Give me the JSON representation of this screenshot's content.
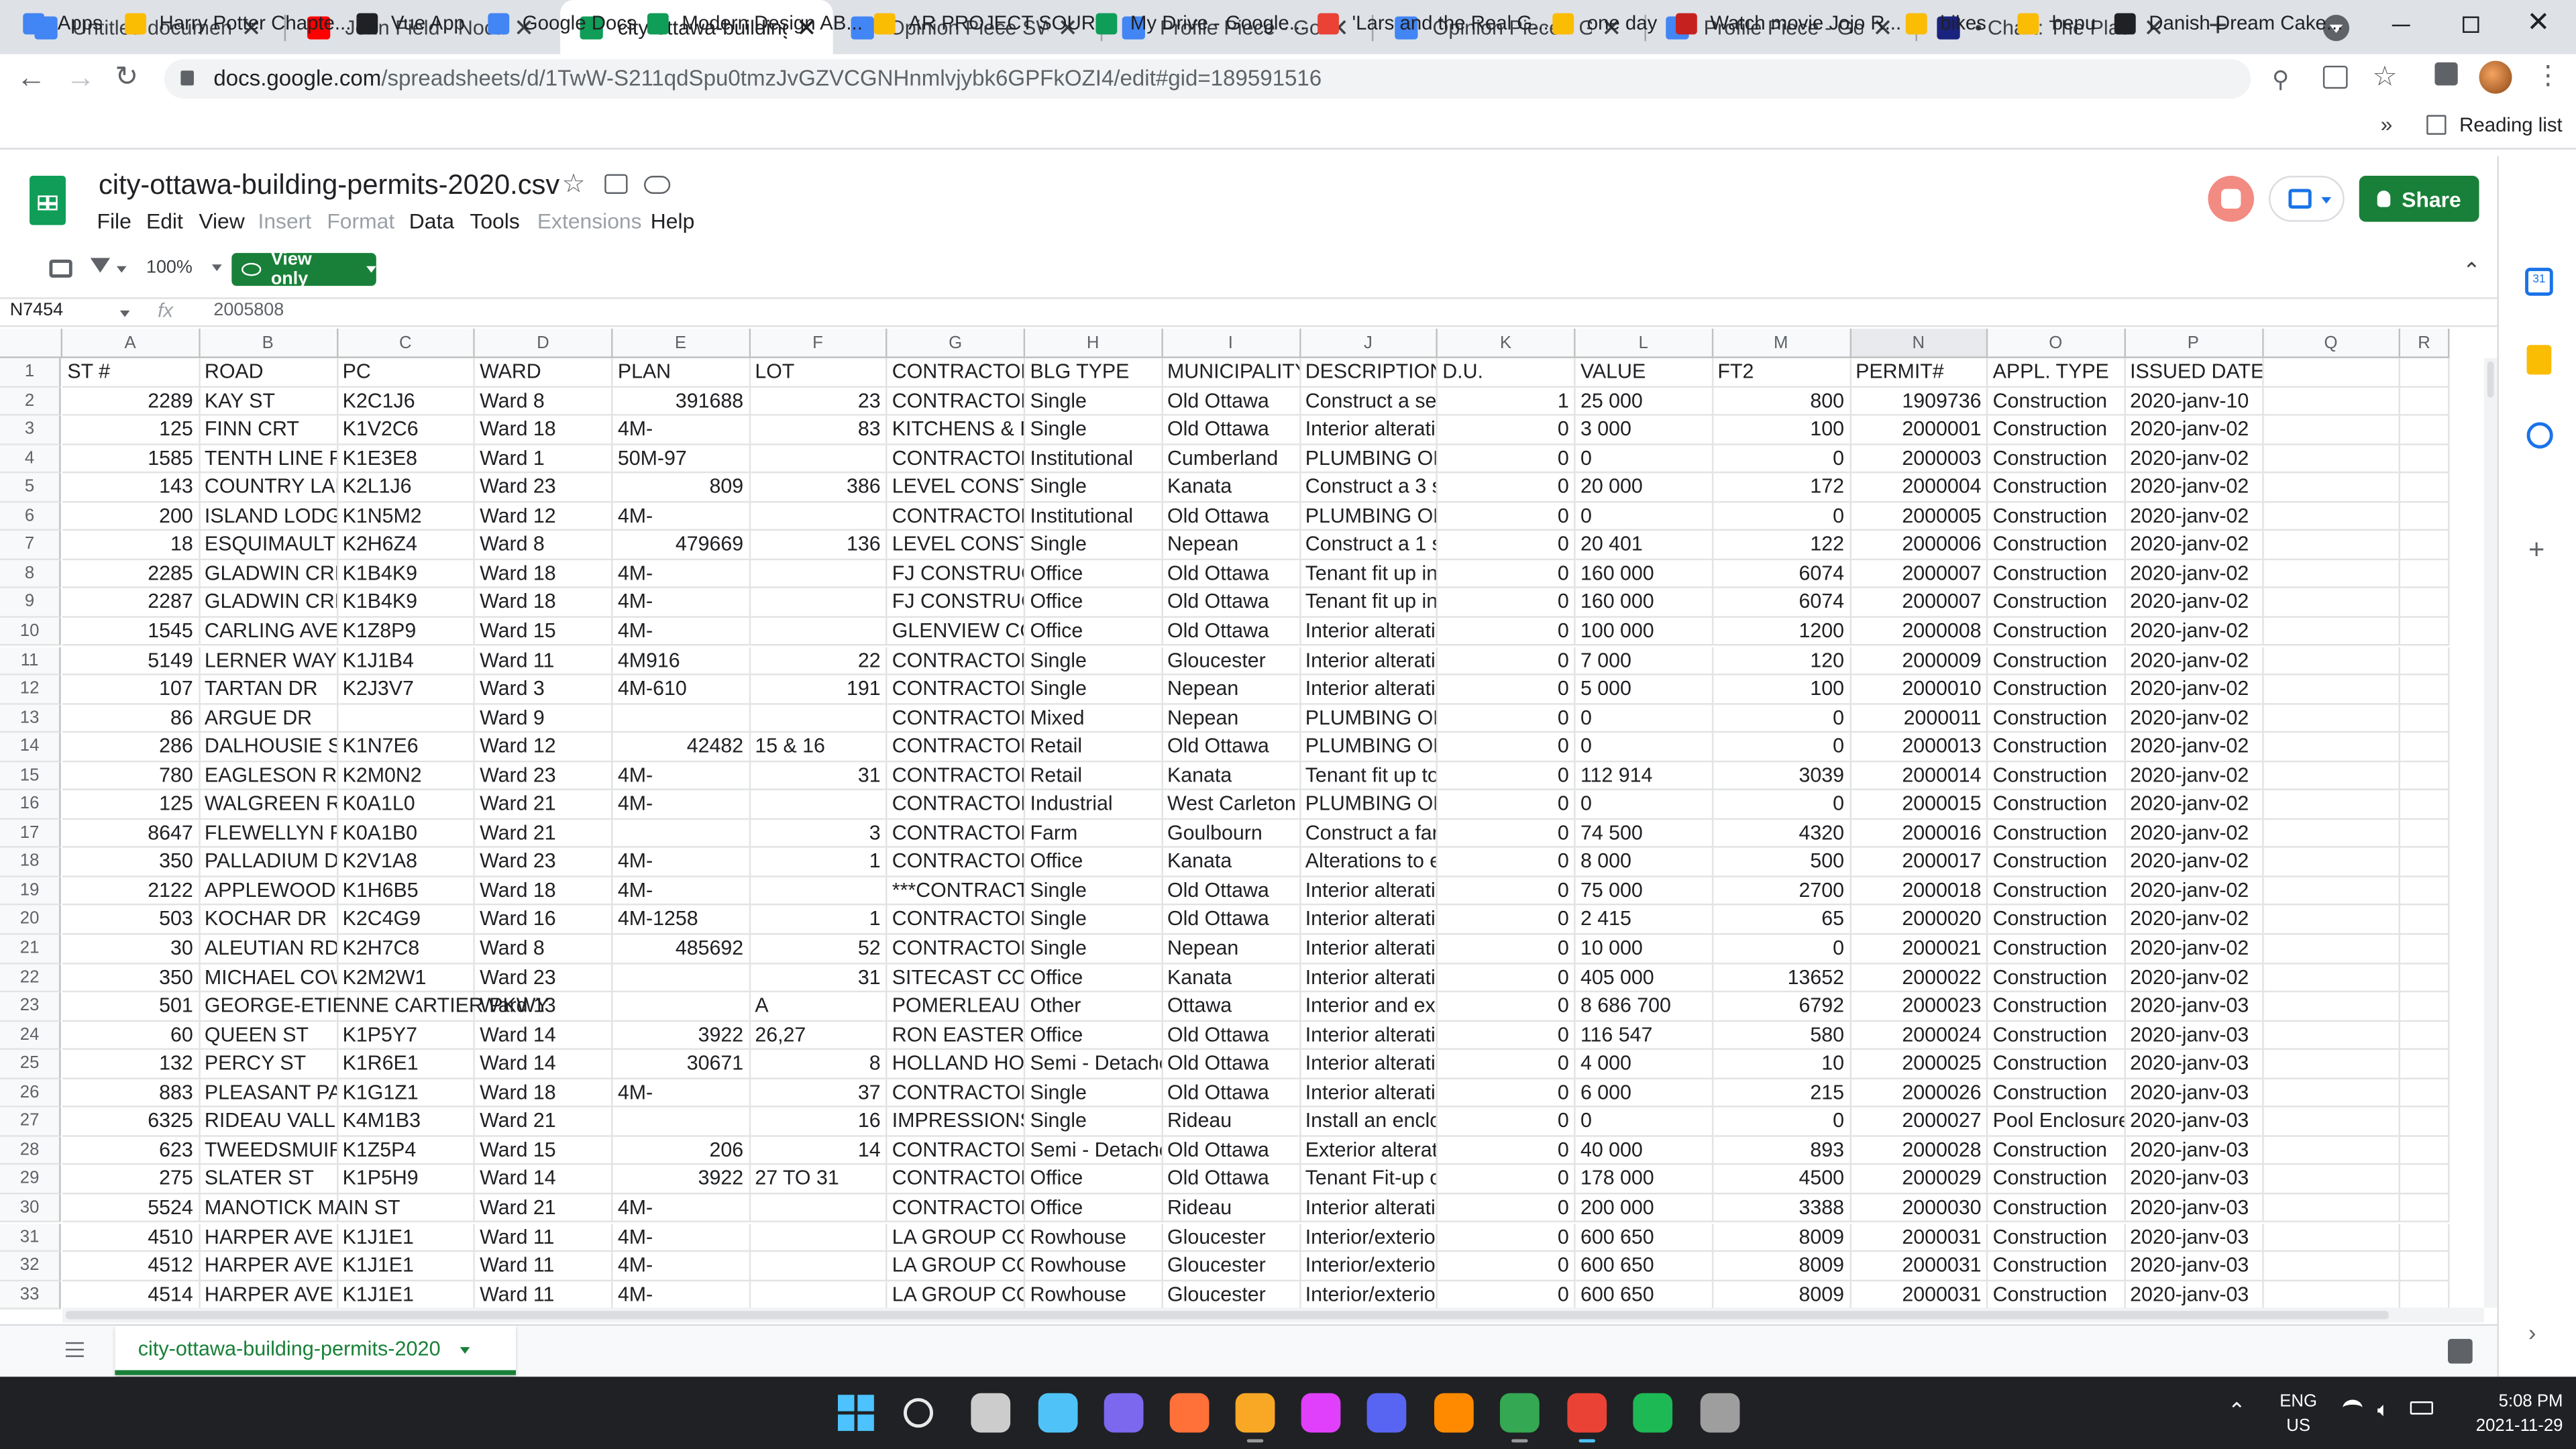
{
  "browser": {
    "tabs": [
      {
        "title": "Untitled document - G",
        "icon": "docs-icon",
        "color": "#4285f4"
      },
      {
        "title": "John Field - Nocturno",
        "icon": "youtube-icon",
        "color": "#ff0000"
      },
      {
        "title": "city-ottawa-building-p",
        "icon": "sheets-icon",
        "color": "#0f9d58"
      },
      {
        "title": "Opinion Piece SWarw",
        "icon": "docs-icon",
        "color": "#4285f4"
      },
      {
        "title": "Profile Piece - Google",
        "icon": "docs-icon",
        "color": "#4285f4"
      },
      {
        "title": "Opinion Piece - Goog",
        "icon": "docs-icon",
        "color": "#4285f4"
      },
      {
        "title": "Profile Piece - Google",
        "icon": "docs-icon",
        "color": "#4285f4"
      },
      {
        "title": "• Chart: The Places W",
        "icon": "chart-icon",
        "color": "#1a237e"
      }
    ],
    "new_tab": "+",
    "url_host": "docs.google.com",
    "url_path": "/spreadsheets/d/1TwW-S211qdSpu0tmzJvGZVCGNHnmlvjybk6GPFkOZI4/edit#gid=189591516",
    "bookmarks": [
      {
        "label": "Apps"
      },
      {
        "label": "Harry Potter Chapte..."
      },
      {
        "label": "Vue App"
      },
      {
        "label": "Google Docs"
      },
      {
        "label": "Modern Design AB..."
      },
      {
        "label": "AR PROJECT SOUR..."
      },
      {
        "label": "My Drive - Google..."
      },
      {
        "label": "'Lars and the Real G..."
      },
      {
        "label": "one day"
      },
      {
        "label": "Watch movie Jojo R..."
      },
      {
        "label": "bikes"
      },
      {
        "label": "bepu"
      },
      {
        "label": "Danish Dream Cake..."
      }
    ],
    "more_bookmarks": "»",
    "reading_list": "Reading list"
  },
  "sheet": {
    "title": "city-ottawa-building-permits-2020.csv",
    "menu": [
      {
        "label": "File",
        "dim": false
      },
      {
        "label": "Edit",
        "dim": false
      },
      {
        "label": "View",
        "dim": false
      },
      {
        "label": "Insert",
        "dim": true
      },
      {
        "label": "Format",
        "dim": true
      },
      {
        "label": "Data",
        "dim": false
      },
      {
        "label": "Tools",
        "dim": false
      },
      {
        "label": "Extensions",
        "dim": true
      },
      {
        "label": "Help",
        "dim": false
      }
    ],
    "share_label": "Share",
    "zoom": "100%",
    "view_only": "View only",
    "name_box": "N7454",
    "fx": "fx",
    "formula_value": "2005808",
    "sheet_tab": "city-ottawa-building-permits-2020",
    "columns": [
      "A",
      "B",
      "C",
      "D",
      "E",
      "F",
      "G",
      "H",
      "I",
      "J",
      "K",
      "L",
      "M",
      "N",
      "O",
      "P",
      "Q",
      "R"
    ],
    "selected_column": "N",
    "rows": [
      [
        "ST #",
        "ROAD",
        "PC",
        "WARD",
        "PLAN",
        "LOT",
        "CONTRACTOR",
        "BLG TYPE",
        "MUNICIPALITY",
        "DESCRIPTION",
        "D.U.",
        "VALUE",
        "FT2",
        "PERMIT#",
        "APPL. TYPE",
        "ISSUED DATE"
      ],
      [
        "2289",
        "KAY ST",
        "K2C1J6",
        "Ward 8",
        "391688",
        "23",
        "CONTRACTOR",
        "Single",
        "Old Ottawa",
        "Construct a secc",
        "1",
        "25 000",
        "800",
        "1909736",
        "Construction",
        "2020-janv-10"
      ],
      [
        "125",
        "FINN CRT",
        "K1V2C6",
        "Ward 18",
        "4M-",
        "83",
        "KITCHENS & BA",
        "Single",
        "Old Ottawa",
        "Interior alteration",
        "0",
        "3 000",
        "100",
        "2000001",
        "Construction",
        "2020-janv-02"
      ],
      [
        "1585",
        "TENTH LINE RD",
        "K1E3E8",
        "Ward 1",
        "50M-97",
        "",
        "CONTRACTOR",
        "Institutional",
        "Cumberland",
        "PLUMBING ONL",
        "0",
        "0",
        "0",
        "2000003",
        "Construction",
        "2020-janv-02"
      ],
      [
        "143",
        "COUNTRY LANE",
        "K2L1J6",
        "Ward 23",
        "809",
        "386",
        "LEVEL CONSTR",
        "Single",
        "Kanata",
        "Construct a 3 se",
        "0",
        "20 000",
        "172",
        "2000004",
        "Construction",
        "2020-janv-02"
      ],
      [
        "200",
        "ISLAND LODGE",
        "K1N5M2",
        "Ward 12",
        "4M-",
        "",
        "CONTRACTOR",
        "Institutional",
        "Old Ottawa",
        "PLUMBING ONL",
        "0",
        "0",
        "0",
        "2000005",
        "Construction",
        "2020-janv-02"
      ],
      [
        "18",
        "ESQUIMAULT A",
        "K2H6Z4",
        "Ward 8",
        "479669",
        "136",
        "LEVEL CONSTR",
        "Single",
        "Nepean",
        "Construct a 1 stc",
        "0",
        "20 401",
        "122",
        "2000006",
        "Construction",
        "2020-janv-02"
      ],
      [
        "2285",
        "GLADWIN CRES",
        "K1B4K9",
        "Ward 18",
        "4M-",
        "",
        "FJ CONSTRUCT",
        "Office",
        "Old Ottawa",
        "Tenant fit up in a",
        "0",
        "160 000",
        "6074",
        "2000007",
        "Construction",
        "2020-janv-02"
      ],
      [
        "2287",
        "GLADWIN CRES",
        "K1B4K9",
        "Ward 18",
        "4M-",
        "",
        "FJ CONSTRUCT",
        "Office",
        "Old Ottawa",
        "Tenant fit up in a",
        "0",
        "160 000",
        "6074",
        "2000007",
        "Construction",
        "2020-janv-02"
      ],
      [
        "1545",
        "CARLING AVE",
        "K1Z8P9",
        "Ward 15",
        "4M-",
        "",
        "GLENVIEW CON",
        "Office",
        "Old Ottawa",
        "Interior alteration",
        "0",
        "100 000",
        "1200",
        "2000008",
        "Construction",
        "2020-janv-02"
      ],
      [
        "5149",
        "LERNER WAY",
        "K1J1B4",
        "Ward 11",
        "4M916",
        "22",
        "CONTRACTOR",
        "Single",
        "Gloucester",
        "Interior alteration",
        "0",
        "7 000",
        "120",
        "2000009",
        "Construction",
        "2020-janv-02"
      ],
      [
        "107",
        "TARTAN DR",
        "K2J3V7",
        "Ward 3",
        "4M-610",
        "191",
        "CONTRACTOR",
        "Single",
        "Nepean",
        "Interior alteration",
        "0",
        "5 000",
        "100",
        "2000010",
        "Construction",
        "2020-janv-02"
      ],
      [
        "86",
        "ARGUE DR",
        "",
        "Ward 9",
        "",
        "",
        "CONTRACTOR",
        "Mixed",
        "Nepean",
        "PLUMBING ONL",
        "0",
        "0",
        "0",
        "2000011",
        "Construction",
        "2020-janv-02"
      ],
      [
        "286",
        "DALHOUSIE ST",
        "K1N7E6",
        "Ward 12",
        "42482",
        "15 & 16",
        "CONTRACTOR",
        "Retail",
        "Old Ottawa",
        "PLUMBING ONL",
        "0",
        "0",
        "0",
        "2000013",
        "Construction",
        "2020-janv-02"
      ],
      [
        "780",
        "EAGLESON RD",
        "K2M0N2",
        "Ward 23",
        "4M-",
        "31",
        "CONTRACTOR",
        "Retail",
        "Kanata",
        "Tenant fit up to a",
        "0",
        "112 914",
        "3039",
        "2000014",
        "Construction",
        "2020-janv-02"
      ],
      [
        "125",
        "WALGREEN RD",
        "K0A1L0",
        "Ward 21",
        "4M-",
        "",
        "CONTRACTOR",
        "Industrial",
        "West Carleton",
        "PLUMBING ONL",
        "0",
        "0",
        "0",
        "2000015",
        "Construction",
        "2020-janv-02"
      ],
      [
        "8647",
        "FLEWELLYN RD",
        "K0A1B0",
        "Ward 21",
        "",
        "3",
        "CONTRACTOR",
        "Farm",
        "Goulbourn",
        "Construct a farm",
        "0",
        "74 500",
        "4320",
        "2000016",
        "Construction",
        "2020-janv-02"
      ],
      [
        "350",
        "PALLADIUM DR",
        "K2V1A8",
        "Ward 23",
        "4M-",
        "1",
        "CONTRACTOR",
        "Office",
        "Kanata",
        "Alterations to ex",
        "0",
        "8 000",
        "500",
        "2000017",
        "Construction",
        "2020-janv-02"
      ],
      [
        "2122",
        "APPLEWOOD C",
        "K1H6B5",
        "Ward 18",
        "4M-",
        "",
        "***CONTRACTO",
        "Single",
        "Old Ottawa",
        "Interior alteration",
        "0",
        "75 000",
        "2700",
        "2000018",
        "Construction",
        "2020-janv-02"
      ],
      [
        "503",
        "KOCHAR DR",
        "K2C4G9",
        "Ward 16",
        "4M-1258",
        "1",
        "CONTRACTOR",
        "Single",
        "Old Ottawa",
        "Interior alteration",
        "0",
        "2 415",
        "65",
        "2000020",
        "Construction",
        "2020-janv-02"
      ],
      [
        "30",
        "ALEUTIAN RD",
        "K2H7C8",
        "Ward 8",
        "485692",
        "52",
        "CONTRACTOR",
        "Single",
        "Nepean",
        "Interior alteration",
        "0",
        "10 000",
        "0",
        "2000021",
        "Construction",
        "2020-janv-02"
      ],
      [
        "350",
        "MICHAEL COWI",
        "K2M2W1",
        "Ward 23",
        "",
        "31",
        "SITECAST CON",
        "Office",
        "Kanata",
        "Interior alteration",
        "0",
        "405 000",
        "13652",
        "2000022",
        "Construction",
        "2020-janv-02"
      ],
      [
        "501",
        "GEORGE-ETIENNE CARTIER PKWY",
        "",
        "Ward 13",
        "",
        "A",
        "POMERLEAU IN",
        "Other",
        "Ottawa",
        "Interior and exte",
        "0",
        "8 686 700",
        "6792",
        "2000023",
        "Construction",
        "2020-janv-03"
      ],
      [
        "60",
        "QUEEN ST",
        "K1P5Y7",
        "Ward 14",
        "3922",
        "26,27",
        "RON EASTERN",
        "Office",
        "Old Ottawa",
        "Interior alteration",
        "0",
        "116 547",
        "580",
        "2000024",
        "Construction",
        "2020-janv-03"
      ],
      [
        "132",
        "PERCY ST",
        "K1R6E1",
        "Ward 14",
        "30671",
        "8",
        "HOLLAND HOM",
        "Semi - Detached",
        "Old Ottawa",
        "Interior alteration",
        "0",
        "4 000",
        "10",
        "2000025",
        "Construction",
        "2020-janv-03"
      ],
      [
        "883",
        "PLEASANT PAR",
        "K1G1Z1",
        "Ward 18",
        "4M-",
        "37",
        "CONTRACTOR",
        "Single",
        "Old Ottawa",
        "Interior alteration",
        "0",
        "6 000",
        "215",
        "2000026",
        "Construction",
        "2020-janv-03"
      ],
      [
        "6325",
        "RIDEAU VALLEY",
        "K4M1B3",
        "Ward 21",
        "",
        "16",
        "IMPRESSIONS",
        "Single",
        "Rideau",
        "Install an enclosu",
        "0",
        "0",
        "0",
        "2000027",
        "Pool Enclosure",
        "2020-janv-03"
      ],
      [
        "623",
        "TWEEDSMUIR A",
        "K1Z5P4",
        "Ward 15",
        "206",
        "14",
        "CONTRACTOR",
        "Semi - Detached",
        "Old Ottawa",
        "Exterior alteratio",
        "0",
        "40 000",
        "893",
        "2000028",
        "Construction",
        "2020-janv-03"
      ],
      [
        "275",
        "SLATER ST",
        "K1P5H9",
        "Ward 14",
        "3922",
        "27 TO 31",
        "CONTRACTOR",
        "Office",
        "Old Ottawa",
        "Tenant Fit-up on",
        "0",
        "178 000",
        "4500",
        "2000029",
        "Construction",
        "2020-janv-03"
      ],
      [
        "5524",
        "MANOTICK MAIN ST",
        "",
        "Ward 21",
        "4M-",
        "",
        "CONTRACTOR",
        "Office",
        "Rideau",
        "Interior alteration",
        "0",
        "200 000",
        "3388",
        "2000030",
        "Construction",
        "2020-janv-03"
      ],
      [
        "4510",
        "HARPER AVE",
        "K1J1E1",
        "Ward 11",
        "4M-",
        "",
        "LA GROUP COR",
        "Rowhouse",
        "Gloucester",
        "Interior/exterior a",
        "0",
        "600 650",
        "8009",
        "2000031",
        "Construction",
        "2020-janv-03"
      ],
      [
        "4512",
        "HARPER AVE",
        "K1J1E1",
        "Ward 11",
        "4M-",
        "",
        "LA GROUP COR",
        "Rowhouse",
        "Gloucester",
        "Interior/exterior a",
        "0",
        "600 650",
        "8009",
        "2000031",
        "Construction",
        "2020-janv-03"
      ],
      [
        "4514",
        "HARPER AVE",
        "K1J1E1",
        "Ward 11",
        "4M-",
        "",
        "LA GROUP COR",
        "Rowhouse",
        "Gloucester",
        "Interior/exterior a",
        "0",
        "600 650",
        "8009",
        "2000031",
        "Construction",
        "2020-janv-03"
      ]
    ]
  },
  "taskbar": {
    "lang1": "ENG",
    "lang2": "US",
    "time": "5:08 PM",
    "date": "2021-11-29"
  },
  "colors": {
    "sheets_green": "#0f9d58",
    "share_green": "#188038",
    "link_blue": "#1a73e8"
  }
}
